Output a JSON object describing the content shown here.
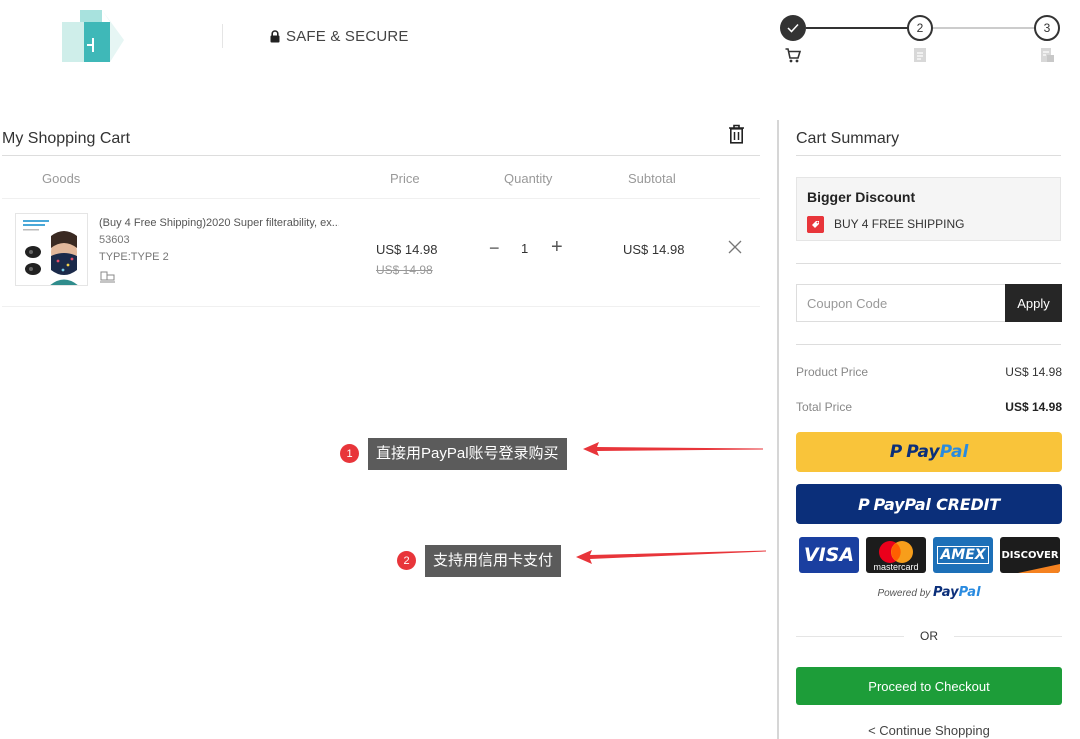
{
  "header": {
    "secure_label": "SAFE & SECURE",
    "steps": [
      {
        "label": "",
        "state": "done",
        "icon": "cart-icon"
      },
      {
        "label": "2",
        "state": "todo",
        "icon": "document-icon"
      },
      {
        "label": "3",
        "state": "todo",
        "icon": "payment-doc-icon"
      }
    ]
  },
  "cart": {
    "title": "My Shopping Cart",
    "columns": {
      "goods": "Goods",
      "price": "Price",
      "quantity": "Quantity",
      "subtotal": "Subtotal"
    },
    "items": [
      {
        "name": "(Buy 4 Free Shipping)2020 Super filterability, ex...",
        "sku": "53603",
        "type": "TYPE:TYPE 2",
        "price": "US$ 14.98",
        "original_price": "US$ 14.98",
        "quantity": "1",
        "qty_minus": "−",
        "qty_plus": "+",
        "subtotal": "US$ 14.98"
      }
    ]
  },
  "annotations": [
    {
      "badge": "1",
      "text": "直接用PayPal账号登录购买"
    },
    {
      "badge": "2",
      "text": "支持用信用卡支付"
    }
  ],
  "summary": {
    "title": "Cart Summary",
    "discount": {
      "title": "Bigger Discount",
      "label": "BUY 4 FREE SHIPPING"
    },
    "coupon_placeholder": "Coupon Code",
    "apply_label": "Apply",
    "product_price_label": "Product Price",
    "product_price": "US$ 14.98",
    "total_price_label": "Total Price",
    "total_price": "US$ 14.98",
    "paypal": {
      "pay": "Pay",
      "pal": "Pal",
      "credit": "PayPal CREDIT",
      "mark": "P"
    },
    "cards": {
      "visa": "VISA",
      "mastercard": "mastercard",
      "amex": "AMEX",
      "discover": "DISCOVER"
    },
    "powered_by": "Powered by",
    "powered_pay": "Pay",
    "powered_pal": "Pal",
    "or": "OR",
    "checkout_label": "Proceed to Checkout",
    "continue_label": "< Continue Shopping"
  },
  "colors": {
    "accent_red": "#e8353a",
    "paypal_yellow": "#f9c43a",
    "paypal_navy": "#0b2f7a",
    "checkout_green": "#1d9d39"
  }
}
